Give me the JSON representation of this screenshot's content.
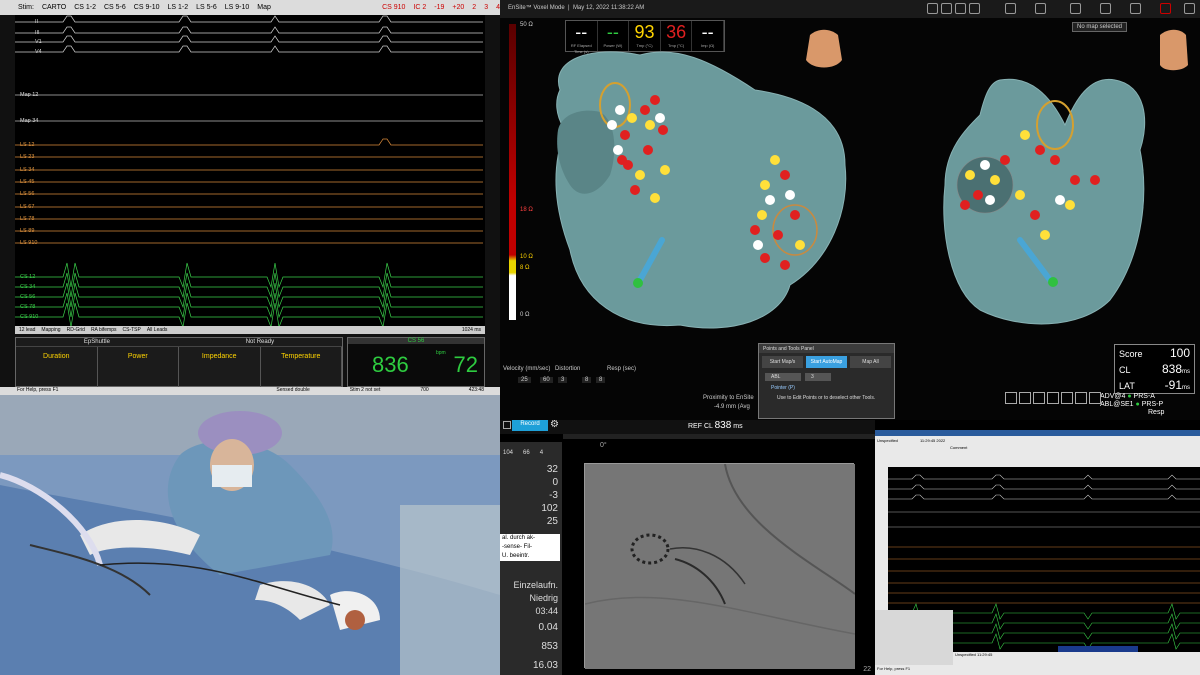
{
  "egm": {
    "toolbar": {
      "mode": "Stim:",
      "srcs": [
        "CARTO",
        "CS 1-2",
        "CS 5-6",
        "CS 9-10",
        "LS 1-2",
        "LS 5-6",
        "LS 9-10"
      ],
      "map": "Map",
      "right": "CS 910",
      "right2": "IC 2",
      "right3": "-19",
      "right4": "+20",
      "right5": "2",
      "right6": "3",
      "right7": "4"
    },
    "leads": [
      "II",
      "III",
      "V1",
      "V4",
      "Map 12",
      "Map 34",
      "LS 12",
      "LS 23",
      "LS 34",
      "LS 45",
      "LS 56",
      "LS 67",
      "LS 78",
      "LS 89",
      "LS 910",
      "CS 12",
      "CS 34",
      "CS 56",
      "CS 78",
      "CS 910"
    ],
    "tabs": [
      "12 lead",
      "Mapping",
      "RD-Grid",
      "RA bifemps",
      "CS-TSP",
      "All Leads"
    ],
    "timebase": "1024 ms",
    "ablation": {
      "title": "EpShuttle",
      "state": "Not Ready",
      "cols": [
        "Duration",
        "Power",
        "Impedance",
        "Temperature"
      ]
    },
    "cs_box": {
      "label": "CS 56",
      "cl": "836",
      "bpm": "72",
      "unit": "bpm"
    },
    "status": {
      "help": "For Help, press F1",
      "sensed": "Sensed double",
      "stim": "Stim 2 not set",
      "ms": "700",
      "time": "423:48"
    }
  },
  "map": {
    "title": "EnSite™ Voxel Mode",
    "date": "May 12, 2022 11:38:22 AM",
    "no_map": "No map selected",
    "metrics": [
      {
        "value": "--",
        "label": "RF Elapsed Time (s)",
        "color": "#ffffff"
      },
      {
        "value": "--",
        "label": "Power (W)",
        "color": "#2ecc40"
      },
      {
        "value": "93",
        "label": "Tmp (°C)",
        "color": "#ffd400"
      },
      {
        "value": "36",
        "label": "Tmp (°C)",
        "color": "#e02020"
      },
      {
        "value": "--",
        "label": "Imp (Ω)",
        "color": "#ffffff"
      }
    ],
    "scale_labels": [
      "50 Ω",
      "18 Ω",
      "10 Ω",
      "8 Ω",
      "0 Ω"
    ],
    "velocity": "Velocity (mm/sec)",
    "distortion": "Distortion",
    "resp": "Resp (sec)",
    "velocity_vals": [
      "25",
      "60",
      "3",
      "8",
      "8"
    ],
    "proximity": "Proximity to EnSite",
    "proximity_val": "-4.9 mm (Avg",
    "panel": {
      "title": "Points and Tools Panel",
      "btns": [
        "Start Map/s",
        "Start AutoMap",
        "Map All"
      ],
      "sel1": "ABL",
      "sel2": "3",
      "pointer": "Pointer (P)",
      "hint": "Use to Edit Points or to deselect other Tools."
    },
    "score": {
      "score_label": "Score",
      "score": "100",
      "cl_label": "CL",
      "cl": "838",
      "cl_unit": "ms",
      "lat_label": "LAT",
      "lat": "-91",
      "lat_unit": "ms"
    },
    "catheters": [
      {
        "name": "ADV@4",
        "status": "PRS-A"
      },
      {
        "name": "ABL@SE1",
        "status": "PRS-P"
      },
      {
        "name": "",
        "status": "Resp"
      }
    ],
    "colors": {
      "accent": "#3aa0e0",
      "ok": "#2ecc40"
    }
  },
  "fluoro": {
    "record": "Record",
    "ref": "REF",
    "cl_label": "CL",
    "cl": "838",
    "cl_unit": "ms",
    "angle": "0°",
    "side": {
      "head": [
        "104",
        "66",
        "4"
      ],
      "vals": [
        "32",
        "0",
        "-3",
        "102",
        "25"
      ],
      "note": [
        "al. durch ak-",
        "-sense- Fil-",
        "U. beeintr."
      ],
      "mode1": "Einzelaufn.",
      "mode2": "Niedrig",
      "time": "03:44",
      "dose": "0.04",
      "dap": "853",
      "kv": "16.03"
    },
    "counter": "22"
  },
  "egm2": {
    "title": "Unspecified",
    "time": "11:29:45 2022",
    "rows": [
      "Unspecified",
      "Unspecified",
      "Unspecified"
    ],
    "rowtimes": [
      "11:28:0",
      "11:28:24",
      "11:29:45"
    ],
    "comment": "Comment",
    "help": "For Help, press F1"
  }
}
